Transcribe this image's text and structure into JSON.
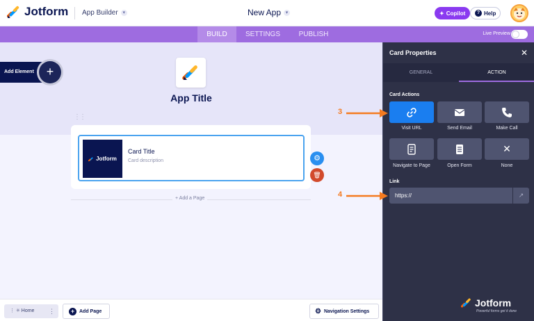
{
  "header": {
    "brand": "Jotform",
    "app_builder": "App Builder",
    "app_name": "New App",
    "copilot": "Copilot",
    "help": "Help"
  },
  "tabs": {
    "build": "BUILD",
    "settings": "SETTINGS",
    "publish": "PUBLISH",
    "live_preview": "Live Preview"
  },
  "canvas": {
    "add_element": "Add Element",
    "app_title": "App Title",
    "card_title": "Card Title",
    "card_description": "Card description",
    "card_thumb_brand": "Jotform",
    "add_page_link": "+ Add a Page"
  },
  "bottom": {
    "home": "Home",
    "add_page": "Add Page",
    "navigation_settings": "Navigation Settings"
  },
  "panel": {
    "title": "Card Properties",
    "tab_general": "GENERAL",
    "tab_action": "ACTION",
    "card_actions_label": "Card Actions",
    "actions": [
      {
        "label": "Visit URL",
        "icon": "link-icon",
        "selected": true
      },
      {
        "label": "Send Email",
        "icon": "envelope-icon",
        "selected": false
      },
      {
        "label": "Make Call",
        "icon": "phone-icon",
        "selected": false
      },
      {
        "label": "Navigate to Page",
        "icon": "page-icon",
        "selected": false
      },
      {
        "label": "Open Form",
        "icon": "form-icon",
        "selected": false
      },
      {
        "label": "None",
        "icon": "x-icon",
        "selected": false
      }
    ],
    "link_label": "Link",
    "link_value": "https://",
    "footer_brand": "Jotform",
    "footer_tagline": "Powerful forms get it done"
  },
  "callouts": {
    "three": "3",
    "four": "4"
  },
  "colors": {
    "accent_purple": "#9e6ce0",
    "selected_action": "#1a7ef0",
    "callout_orange": "#f47a1f",
    "navy": "#0a1551"
  }
}
